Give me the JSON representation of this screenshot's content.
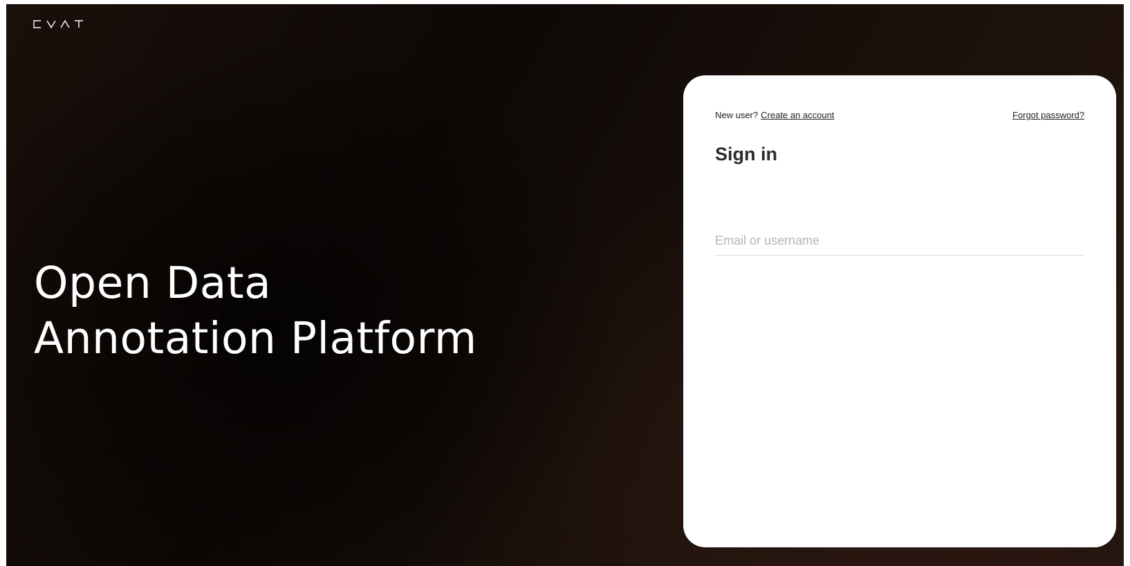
{
  "brand": {
    "logo_text": "CVAT",
    "logo_color": "#ffffff"
  },
  "hero": {
    "line1": "Open Data",
    "line2": "Annotation Platform"
  },
  "signin_card": {
    "new_user_prefix": "New user?",
    "create_account_link": "Create an account",
    "forgot_password_link": "Forgot password?",
    "title": "Sign in",
    "username_field": {
      "value": "",
      "placeholder": "Email or username"
    }
  },
  "colors": {
    "background_dark": "#0d0806",
    "background_warm": "#24160e",
    "card_background": "#ffffff",
    "text_dark": "#1f1f1f",
    "placeholder": "#b5b5b5"
  },
  "icons": {
    "logo": "cvat-logo"
  }
}
